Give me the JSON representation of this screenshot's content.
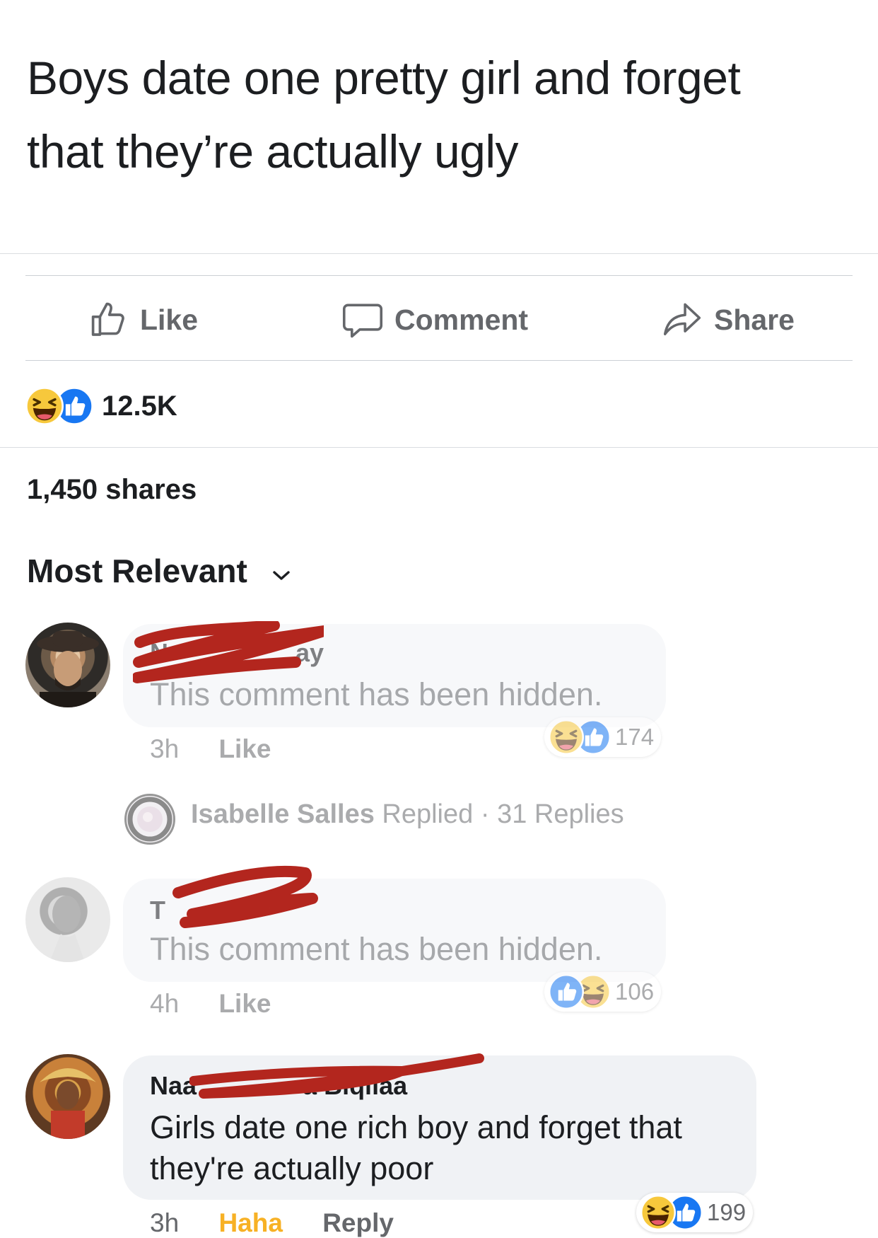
{
  "post": {
    "text_line1": "Boys date one pretty girl and forget",
    "text_line2": "that they’re actually ugly"
  },
  "actions": {
    "like": "Like",
    "comment": "Comment",
    "share": "Share"
  },
  "reactions": {
    "count": "12.5K",
    "icons": [
      "haha-icon",
      "like-icon"
    ]
  },
  "shares": "1,450 shares",
  "sort": {
    "label": "Most Relevant",
    "icon": "chevron-down-icon"
  },
  "comments": [
    {
      "name_fragment_left": "N",
      "name_fragment_right": "ay",
      "text": "This comment has been hidden.",
      "time": "3h",
      "like": "Like",
      "reaction_count": "174",
      "reaction_icons": [
        "haha-icon",
        "like-icon"
      ],
      "hidden": true
    },
    {
      "name_fragment_left": "T",
      "text": "This comment has been hidden.",
      "time": "4h",
      "like": "Like",
      "reaction_count": "106",
      "reaction_icons": [
        "like-icon",
        "haha-icon"
      ],
      "hidden": true
    },
    {
      "name_fragment_left": "Naa",
      "name_fragment_right": "a Biqilaa",
      "text_line1": "Girls date one rich boy and forget that",
      "text_line2": "they're actually poor",
      "time": "3h",
      "haha": "Haha",
      "reply": "Reply",
      "reaction_count": "199",
      "reaction_icons": [
        "haha-icon",
        "like-icon"
      ],
      "hidden": false
    }
  ],
  "replies_summary": {
    "name": "Isabelle Salles",
    "replied": "Replied",
    "separator": "·",
    "count": "31 Replies"
  },
  "colors": {
    "haha_active": "#f7b125",
    "like_blue": "#1877f2",
    "redaction": "#b3261e"
  }
}
